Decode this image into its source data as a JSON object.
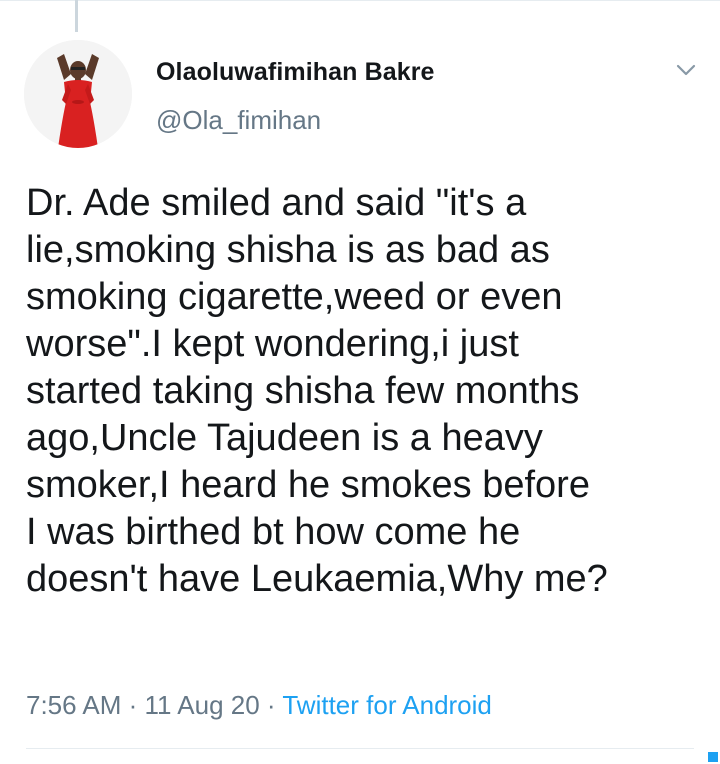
{
  "tweet": {
    "display_name": "Olaoluwafimihan Bakre",
    "handle": "@Ola_fimihan",
    "text": "Dr. Ade smiled and said \"it's a\nlie,smoking shisha is as bad as\nsmoking cigarette,weed or even\nworse\".I kept wondering,i just\nstarted taking shisha few months\nago,Uncle Tajudeen is a heavy\nsmoker,I heard he smokes before\nI was birthed bt how come he\ndoesn't have Leukaemia,Why me?",
    "time": "7:56 AM",
    "separator1": " · ",
    "date": "11 Aug 20",
    "separator2": " · ",
    "source": "Twitter for Android"
  },
  "icons": {
    "menu": "chevron-down-icon",
    "avatar": "avatar"
  },
  "colors": {
    "text": "#14171a",
    "secondary": "#657786",
    "link": "#1da1f2",
    "divider": "#e6ecf0",
    "avatar_outfit": "#d92121"
  }
}
